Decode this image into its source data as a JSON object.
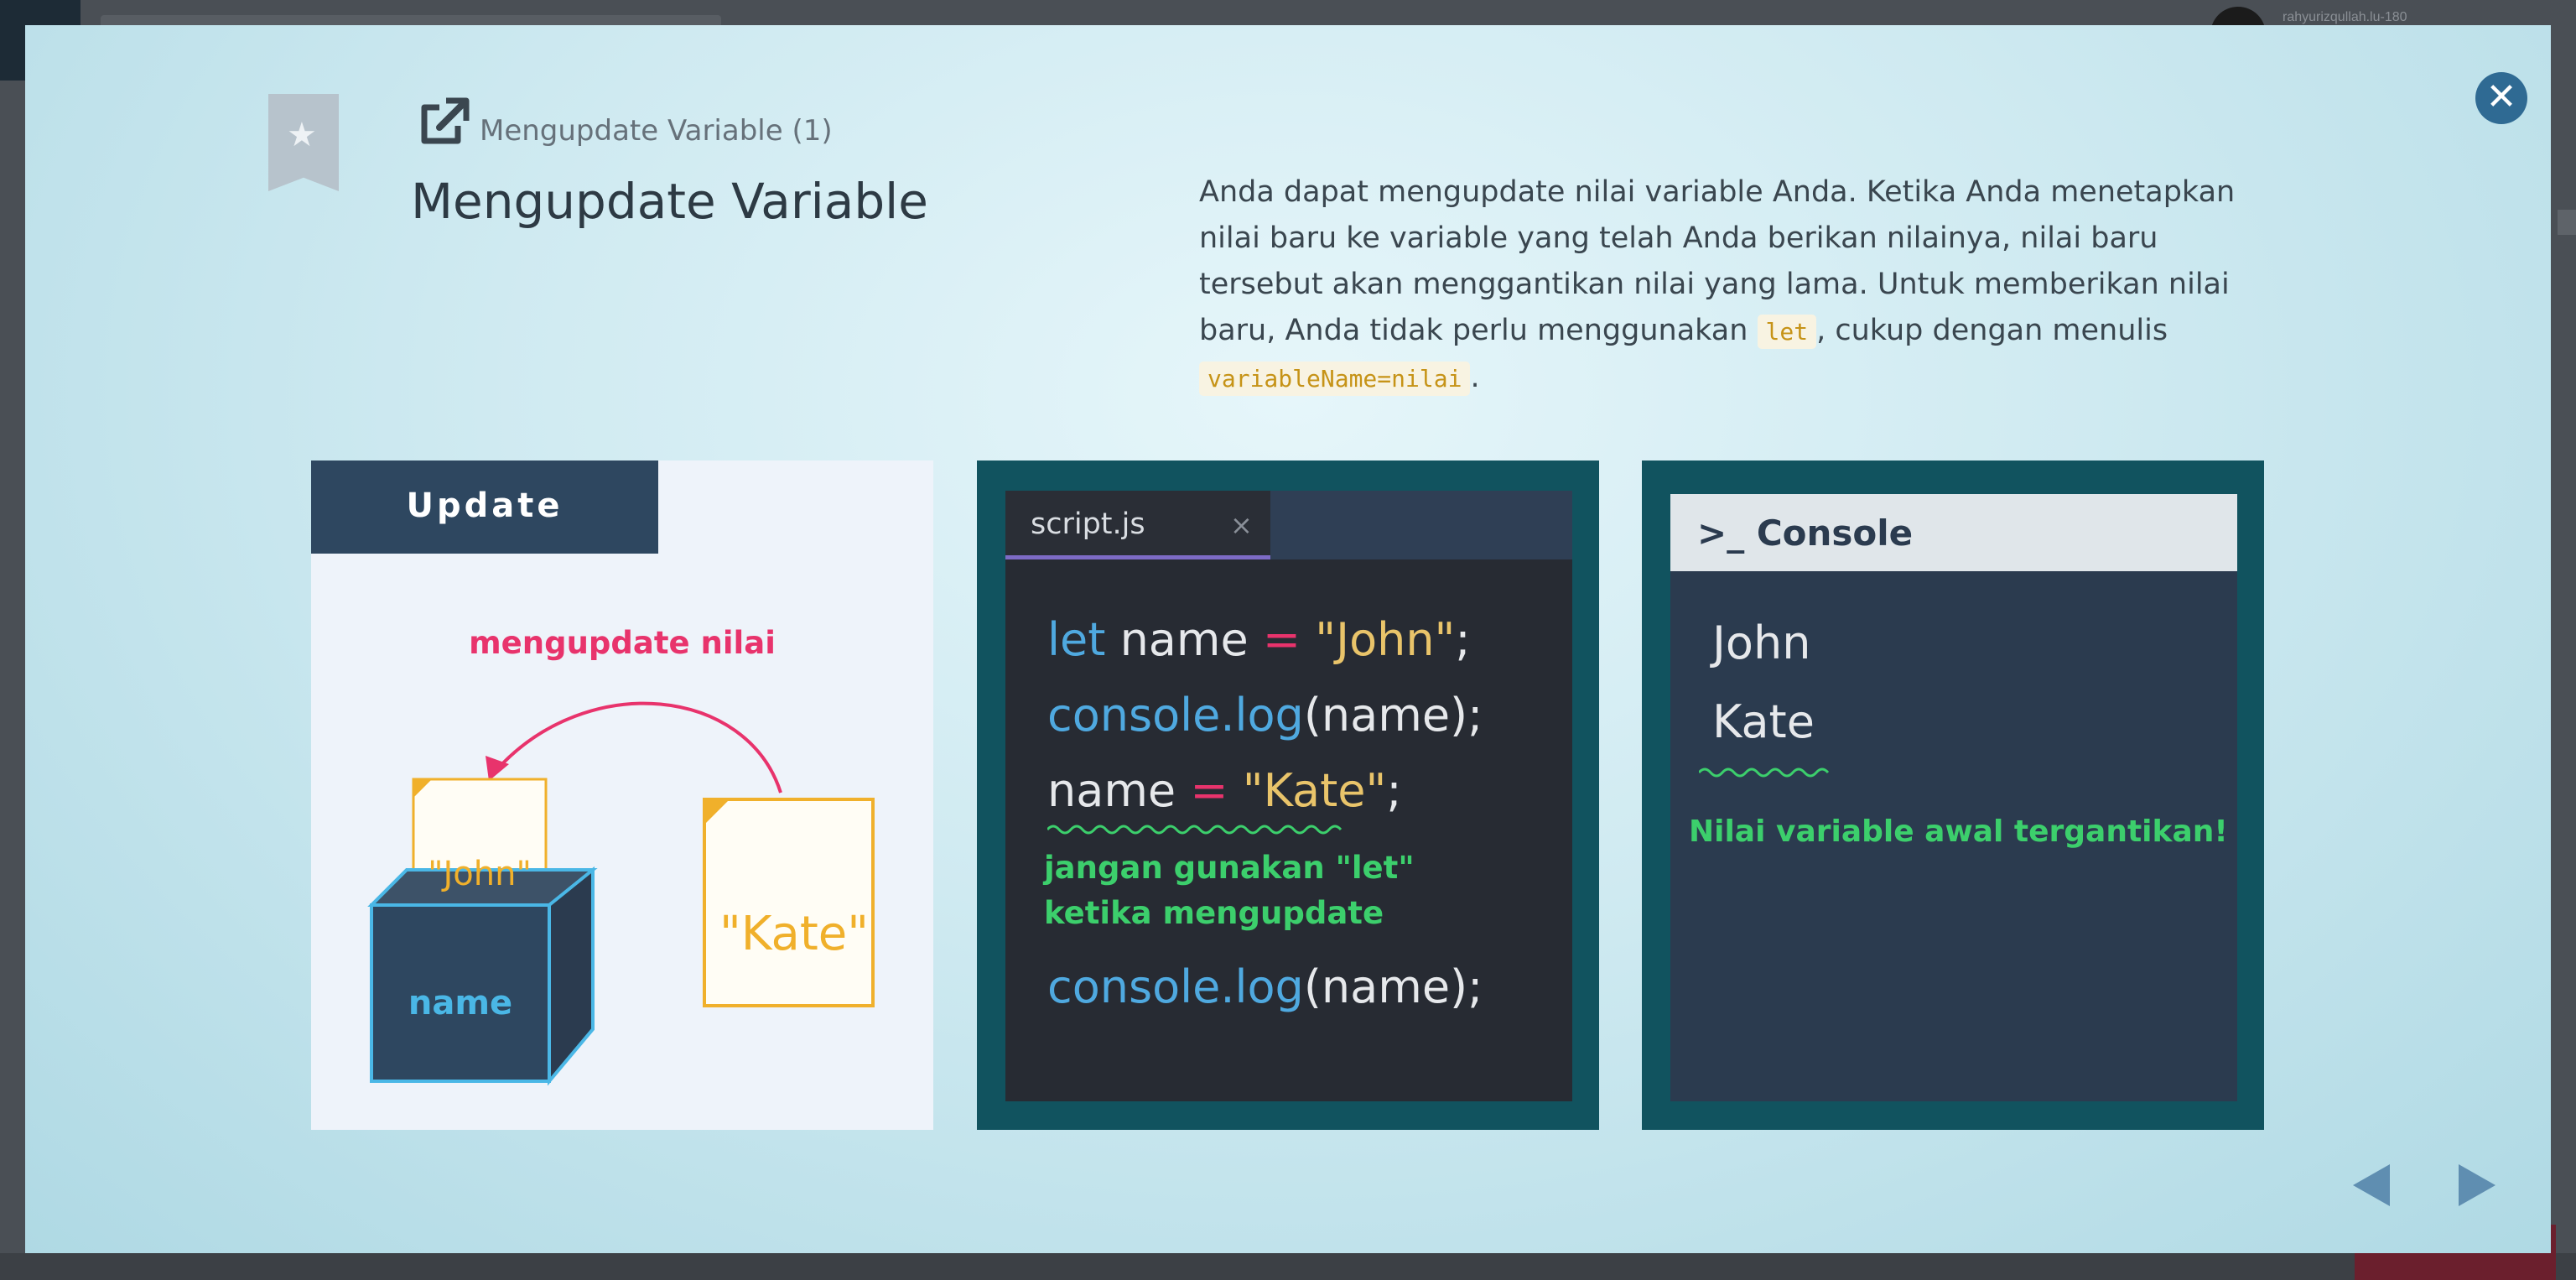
{
  "background": {
    "user_label": "rahyurizqullah.lu-180"
  },
  "modal": {
    "subtitle": "Mengupdate Variable (1)",
    "title": "Mengupdate Variable",
    "description": {
      "text1": "Anda dapat mengupdate nilai variable Anda. Ketika Anda menetapkan nilai baru ke variable yang telah Anda berikan nilainya, nilai baru tersebut akan menggantikan nilai yang lama. Untuk memberikan nilai baru, Anda tidak perlu menggunakan ",
      "code1": "let",
      "text2": ", cukup dengan menulis ",
      "code2": "variableName=nilai",
      "text3": "."
    },
    "close_icon": "close-icon",
    "bookmark_icon": "bookmark-star-icon",
    "link_icon": "external-link-icon"
  },
  "panel1": {
    "tab_label": "Update",
    "arrow_label": "mengupdate nilai",
    "old_value": "\"John\"",
    "new_value": "\"Kate\"",
    "box_label": "name"
  },
  "panel2": {
    "file_name": "script.js",
    "tab_close": "×",
    "line1": {
      "kw": "let",
      "name": " name ",
      "op": "=",
      "str": " \"John\"",
      "end": ";"
    },
    "line2": {
      "fn": "console.log",
      "args": "(name);"
    },
    "line3": {
      "name": "name ",
      "op": "=",
      "str": " \"Kate\"",
      "end": ";"
    },
    "note1": "jangan gunakan \"let\"",
    "note2": "ketika mengupdate",
    "line4": {
      "fn": "console.log",
      "args": "(name);"
    }
  },
  "panel3": {
    "prompt": ">_",
    "title": "Console",
    "output1": "John",
    "output2": "Kate",
    "note": "Nilai variable awal tergantikan!"
  },
  "colors": {
    "accent_pink": "#e8336c",
    "code_blue": "#4fa9e0",
    "note_green": "#3ccf6c",
    "doc_yellow": "#f0b02b"
  }
}
